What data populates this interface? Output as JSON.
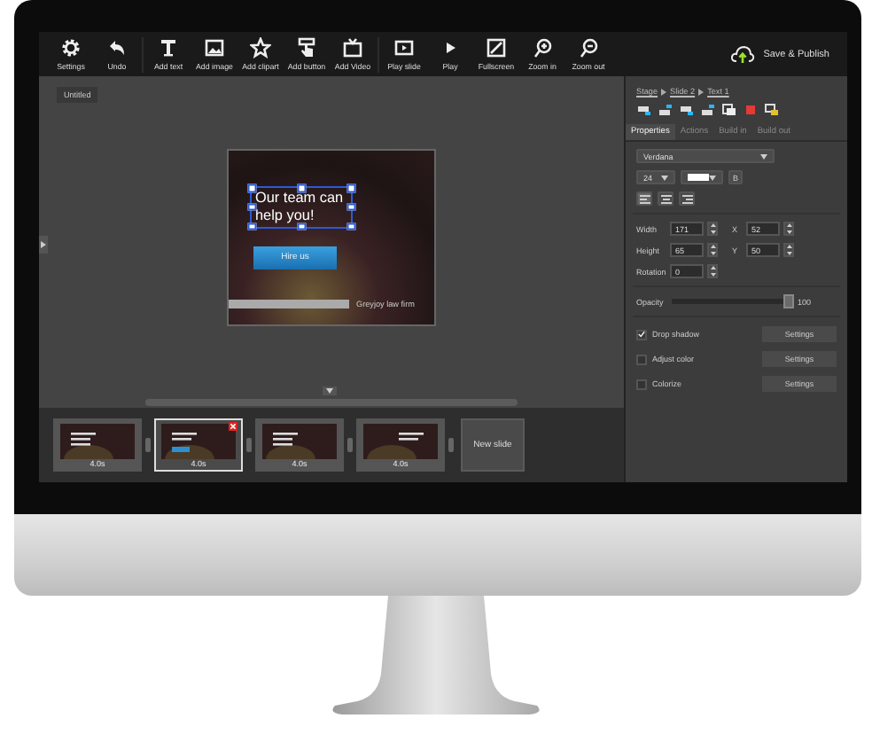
{
  "toolbar": {
    "groups": [
      [
        {
          "label": "Settings"
        },
        {
          "label": "Undo"
        }
      ],
      [
        {
          "label": "Add text"
        },
        {
          "label": "Add image"
        },
        {
          "label": "Add clipart"
        },
        {
          "label": "Add button"
        },
        {
          "label": "Add Video"
        }
      ],
      [
        {
          "label": "Play slide"
        },
        {
          "label": "Play"
        },
        {
          "label": "Fullscreen"
        },
        {
          "label": "Zoom in"
        },
        {
          "label": "Zoom out"
        }
      ]
    ],
    "publish_button": "Save & Publish"
  },
  "canvas": {
    "tab": "Untitled",
    "slide": {
      "heading": "Our team can help you!",
      "button": "Hire us",
      "caption": "Greyjoy law firm"
    }
  },
  "filmstrip": {
    "slides": [
      {
        "duration": "4.0s",
        "selected": false
      },
      {
        "duration": "4.0s",
        "selected": true
      },
      {
        "duration": "4.0s",
        "selected": false
      },
      {
        "duration": "4.0s",
        "selected": false
      }
    ],
    "new_slide": "New slide"
  },
  "panel": {
    "breadcrumb": [
      "Stage",
      "Slide 2",
      "Text 1"
    ],
    "tabs": [
      {
        "label": "Properties",
        "selected": true
      },
      {
        "label": "Actions",
        "selected": false
      },
      {
        "label": "Build in",
        "selected": false
      },
      {
        "label": "Build out",
        "selected": false
      }
    ],
    "font": "Verdana",
    "font_size": "24",
    "bold": "B",
    "fields": [
      [
        {
          "label": "Width",
          "value": "171"
        },
        {
          "label": "X",
          "value": "52"
        }
      ],
      [
        {
          "label": "Height",
          "value": "65"
        },
        {
          "label": "Y",
          "value": "50"
        }
      ],
      [
        {
          "label": "Rotation",
          "value": "0"
        }
      ]
    ],
    "opacity": {
      "label": "Opacity",
      "level": 0.97,
      "reading": "100"
    },
    "effects": [
      {
        "label": "Drop shadow",
        "checked": true,
        "button": "Settings"
      },
      {
        "label": "Adjust color",
        "checked": false,
        "button": "Settings"
      },
      {
        "label": "Colorize",
        "checked": false,
        "button": "Settings"
      }
    ]
  }
}
